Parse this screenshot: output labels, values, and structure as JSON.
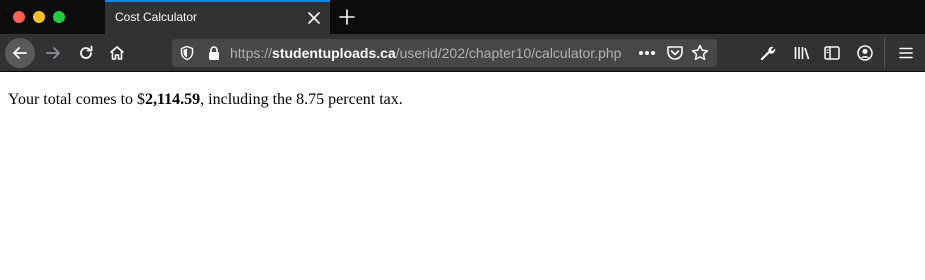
{
  "tab": {
    "title": "Cost Calculator"
  },
  "url": {
    "scheme": "https://",
    "host": "studentuploads.ca",
    "path": "/userid/202/chapter10/calculator.php"
  },
  "page": {
    "before_amount": "Your total comes to $",
    "amount": "2,114.59",
    "after_amount": ", including the 8.75 percent tax."
  },
  "colors": {
    "tab_accent": "#0a84ff",
    "toolbar": "#323234",
    "titlebar": "#0c0c0d"
  }
}
